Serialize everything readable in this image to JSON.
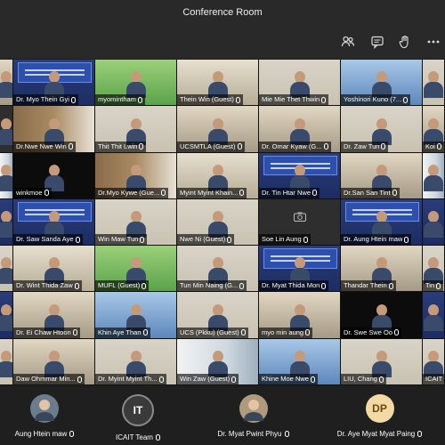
{
  "window": {
    "title": "Conference Room"
  },
  "toolbar": {
    "icons": [
      "participants-icon",
      "chat-icon",
      "raise-hand-icon",
      "more-options-icon"
    ]
  },
  "tiles": [
    {
      "name": "",
      "bg": "room"
    },
    {
      "name": "Dr. Myo Thein Gyi",
      "bg": "blue",
      "banner": true
    },
    {
      "name": "myomintham",
      "bg": "green"
    },
    {
      "name": "Thein Win (Guest)",
      "bg": "office"
    },
    {
      "name": "Mie Mie Thet Thwin",
      "bg": "wall"
    },
    {
      "name": "Yoshinori Kuno (7...",
      "bg": "skyblue"
    },
    {
      "name": "",
      "bg": "wall"
    },
    {
      "name": "",
      "bg": "dark"
    },
    {
      "name": "Dr.Nwe Nwe Win",
      "bg": "shelf"
    },
    {
      "name": "Thit Thit Lwin",
      "bg": "wall"
    },
    {
      "name": "UCSMTLA (Guest)",
      "bg": "room"
    },
    {
      "name": "Dr. Omar Kyaw (G...",
      "bg": "room"
    },
    {
      "name": "Dr. Zaw Tun",
      "bg": "wall"
    },
    {
      "name": "Koi",
      "bg": "room"
    },
    {
      "name": "",
      "bg": "window"
    },
    {
      "name": "winkmoe",
      "bg": "black"
    },
    {
      "name": "Dr.Myo Kywe (Gue...",
      "bg": "shelf"
    },
    {
      "name": "Myint Myint Khain...",
      "bg": "office"
    },
    {
      "name": "Dr. Tin Htar Nwe",
      "bg": "blue",
      "banner": true
    },
    {
      "name": "Dr.San San Tint",
      "bg": "room"
    },
    {
      "name": "",
      "bg": "window"
    },
    {
      "name": "",
      "bg": "blue"
    },
    {
      "name": "Dr. Saw Sanda Aye",
      "bg": "blue",
      "banner": true
    },
    {
      "name": "Win Maw Tun",
      "bg": "wall"
    },
    {
      "name": "Nwe Ni (Guest)",
      "bg": "wall"
    },
    {
      "name": "Soe Lin Aung",
      "bg": "dark",
      "nocam": true
    },
    {
      "name": "Dr. Aung Htein maw",
      "bg": "blue",
      "banner": true
    },
    {
      "name": "",
      "bg": "blue"
    },
    {
      "name": "",
      "bg": "wall"
    },
    {
      "name": "Dr. Wint Thida Zaw",
      "bg": "office"
    },
    {
      "name": "MUFL (Guest)",
      "bg": "green"
    },
    {
      "name": "Tun Min Naing (G...",
      "bg": "wall"
    },
    {
      "name": "Dr. Myat Thida Mon",
      "bg": "blue",
      "banner": true
    },
    {
      "name": "Thandar Thein",
      "bg": "room"
    },
    {
      "name": "Tin",
      "bg": "wall"
    },
    {
      "name": "",
      "bg": "blue"
    },
    {
      "name": "Dr. Ei Chaw Htoon",
      "bg": "room"
    },
    {
      "name": "Khin Aye Than",
      "bg": "skyblue"
    },
    {
      "name": "UCS (Pkku) (Guest)",
      "bg": "wall"
    },
    {
      "name": "myo min aung",
      "bg": "room"
    },
    {
      "name": "Dr. Swe Swe Oo",
      "bg": "black"
    },
    {
      "name": "",
      "bg": "blue"
    },
    {
      "name": "",
      "bg": "wall"
    },
    {
      "name": "Daw Ohmmar Min...",
      "bg": "room"
    },
    {
      "name": "Dr. Myint Myint Th...",
      "bg": "wall"
    },
    {
      "name": "Win Zaw (Guest)",
      "bg": "window"
    },
    {
      "name": "Khine Moe Nwe",
      "bg": "skyblue"
    },
    {
      "name": "LIU, Chang",
      "bg": "wall"
    },
    {
      "name": "ICAIT",
      "bg": "wall"
    }
  ],
  "bottom_participants": [
    {
      "name": "Aung Htein maw",
      "initials": "",
      "avatar_color": "#6b7d8c",
      "photo": true
    },
    {
      "name": "ICAIT Team",
      "initials": "IT",
      "avatar_color": "#3a3a3a",
      "photo": false
    },
    {
      "name": "Dr. Myat Pwint Phyu",
      "initials": "",
      "avatar_color": "#b09a7e",
      "photo": true
    },
    {
      "name": "Dr. Aye Myat Myat Paing",
      "initials": "DP",
      "avatar_color": "#f3d9a4",
      "photo": false
    }
  ]
}
